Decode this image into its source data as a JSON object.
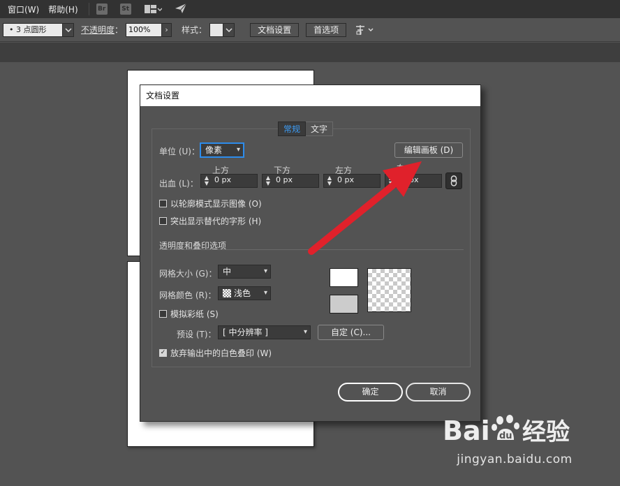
{
  "menubar": {
    "items": [
      "窗口(W)",
      "帮助(H)"
    ],
    "app_icons": [
      "Br",
      "St"
    ],
    "icons": [
      "layout-icon",
      "send-icon"
    ]
  },
  "controlbar": {
    "brush_value": "• 3 点圆形",
    "opacity_label": "不透明度",
    "opacity_value": "100%",
    "style_label": "样式",
    "doc_setup_button": "文档设置",
    "prefs_button": "首选项"
  },
  "dialog": {
    "title": "文档设置",
    "tabs": [
      {
        "label": "常规",
        "active": true
      },
      {
        "label": "文字",
        "active": false
      }
    ],
    "unit_label": "单位 (U)：",
    "unit_value": "像素",
    "edit_artboards_button": "编辑画板 (D)",
    "bleed_label": "出血 (L)：",
    "bleed": {
      "headers": [
        "上方",
        "下方",
        "左方",
        "右"
      ],
      "values": [
        "0 px",
        "0 px",
        "0 px",
        "px"
      ]
    },
    "checkboxes": {
      "outline_mode": "以轮廓模式显示图像 (O)",
      "highlight_glyphs": "突出显示替代的字形 (H)",
      "simulate_paper": "模拟彩纸 (S)",
      "discard_white": "放弃输出中的白色叠印 (W)"
    },
    "checkbox_state": {
      "outline_mode": false,
      "highlight_glyphs": false,
      "simulate_paper": false,
      "discard_white": true
    },
    "transparency_section": "透明度和叠印选项",
    "grid_size_label": "网格大小 (G)：",
    "grid_size_value": "中",
    "grid_color_label": "网格颜色 (R)：",
    "grid_color_value": "浅色",
    "preset_label": "预设 (T)：",
    "preset_value": "[ 中分辨率 ]",
    "custom_button": "自定 (C)...",
    "ok_button": "确定",
    "cancel_button": "取消"
  },
  "watermark": {
    "logo": "Baidu经验",
    "url": "jingyan.baidu.com"
  },
  "colors": {
    "accent": "#2d8ceb",
    "tab_active_text": "#3d9cf5",
    "annotation_arrow": "#e0212b",
    "workspace": "#535353"
  }
}
